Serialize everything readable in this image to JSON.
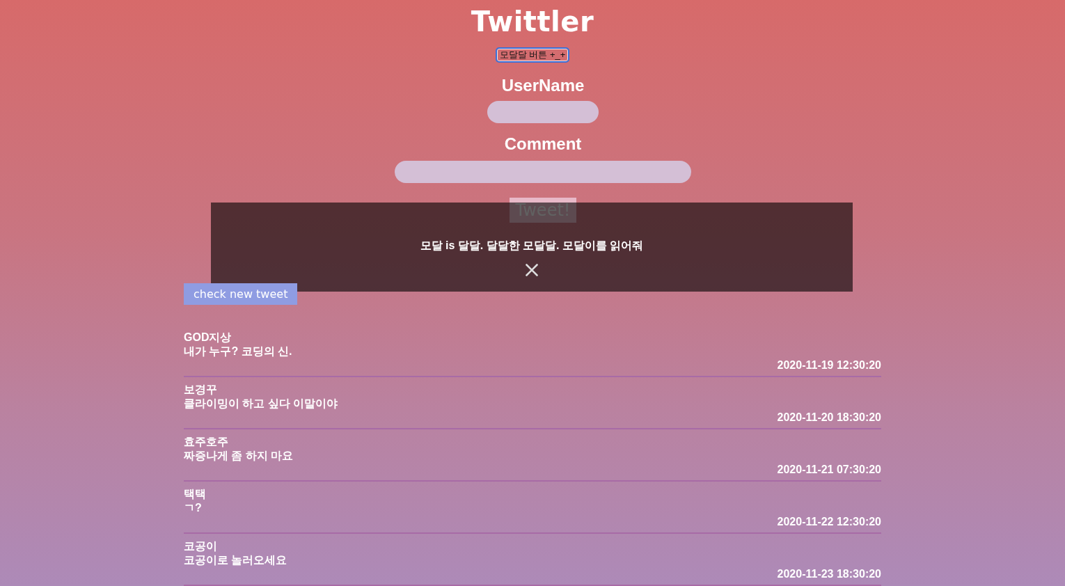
{
  "header": {
    "title": "Twittler"
  },
  "modal_button": {
    "label": "모달달 버튼 +_+",
    "focused": true
  },
  "form": {
    "username": {
      "label": "UserName"
    },
    "comment": {
      "label": "Comment"
    },
    "submit": "Tweet!"
  },
  "modal": {
    "open": true,
    "message": "모달 is 달달. 달달한 모달달. 모달이를 읽어줘"
  },
  "check_button": {
    "label": "check new tweet"
  },
  "tweets": [
    {
      "user": "GOD지상",
      "message": "내가 누구? 코딩의 신.",
      "time": "2020-11-19 12:30:20"
    },
    {
      "user": "보경꾸",
      "message": "클라이밍이 하고 싶다 이말이야",
      "time": "2020-11-20 18:30:20"
    },
    {
      "user": "효주호주",
      "message": "짜증나게 좀 하지 마요",
      "time": "2020-11-21 07:30:20"
    },
    {
      "user": "택택",
      "message": "ㄱ?",
      "time": "2020-11-22 12:30:20"
    },
    {
      "user": "코공이",
      "message": "코공이로 놀러오세요",
      "time": "2020-11-23 18:30:20"
    }
  ]
}
